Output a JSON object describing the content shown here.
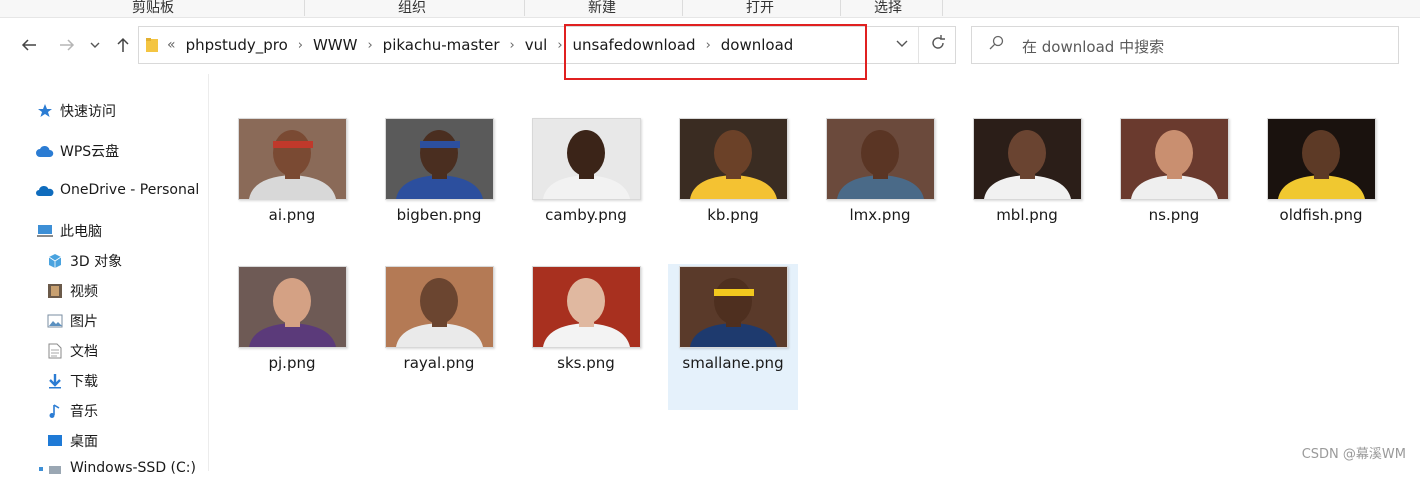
{
  "ribbon": {
    "groups": [
      "剪贴板",
      "组织",
      "新建",
      "打开",
      "选择"
    ]
  },
  "nav": {
    "back_icon": "arrow-left-icon",
    "forward_icon": "arrow-right-icon",
    "recent_icon": "chevron-down-icon",
    "up_icon": "arrow-up-icon"
  },
  "address": {
    "overflow": "«",
    "crumbs": [
      "phpstudy_pro",
      "WWW",
      "pikachu-master",
      "vul",
      "unsafedownload",
      "download"
    ]
  },
  "search": {
    "placeholder": "在 download 中搜索"
  },
  "sidebar": {
    "items": [
      {
        "label": "快速访问",
        "icon": "star-icon"
      },
      {
        "label": "WPS云盘",
        "icon": "cloud-icon"
      },
      {
        "label": "OneDrive - Personal",
        "icon": "onedrive-icon"
      },
      {
        "label": "此电脑",
        "icon": "computer-icon"
      },
      {
        "label": "3D 对象",
        "icon": "cube-icon"
      },
      {
        "label": "视频",
        "icon": "film-icon"
      },
      {
        "label": "图片",
        "icon": "picture-icon"
      },
      {
        "label": "文档",
        "icon": "document-icon"
      },
      {
        "label": "下载",
        "icon": "download-arrow-icon"
      },
      {
        "label": "音乐",
        "icon": "music-note-icon"
      },
      {
        "label": "桌面",
        "icon": "desktop-icon"
      },
      {
        "label": "Windows-SSD (C:)",
        "icon": "drive-icon"
      }
    ]
  },
  "files": [
    {
      "name": "ai.png",
      "bg": "#8a6a58",
      "skin": "#7a4a33",
      "jersey": "#d8d8d8",
      "band": "#c0392b"
    },
    {
      "name": "bigben.png",
      "bg": "#5a5a5a",
      "skin": "#4a2e20",
      "jersey": "#2c4f9e",
      "band": "#2c4f9e"
    },
    {
      "name": "camby.png",
      "bg": "#e8e8e8",
      "skin": "#3b2418",
      "jersey": "#f2f2f2",
      "band": ""
    },
    {
      "name": "kb.png",
      "bg": "#3a2c22",
      "skin": "#6b4128",
      "jersey": "#f4c232",
      "band": ""
    },
    {
      "name": "lmx.png",
      "bg": "#6b4a3c",
      "skin": "#5a3524",
      "jersey": "#4a6a88",
      "band": ""
    },
    {
      "name": "mbl.png",
      "bg": "#2b1e18",
      "skin": "#6a4431",
      "jersey": "#f1f1f1",
      "band": ""
    },
    {
      "name": "ns.png",
      "bg": "#6a3a2e",
      "skin": "#c98f70",
      "jersey": "#efefef",
      "band": ""
    },
    {
      "name": "oldfish.png",
      "bg": "#1a120e",
      "skin": "#5d3a26",
      "jersey": "#f0c830",
      "band": ""
    },
    {
      "name": "pj.png",
      "bg": "#6e5a55",
      "skin": "#d4a184",
      "jersey": "#5b3a7a",
      "band": ""
    },
    {
      "name": "rayal.png",
      "bg": "#b47a55",
      "skin": "#6b4530",
      "jersey": "#eaeaea",
      "band": ""
    },
    {
      "name": "sks.png",
      "bg": "#a8301f",
      "skin": "#e0b8a0",
      "jersey": "#f3f3f3",
      "band": ""
    },
    {
      "name": "smallane.png",
      "bg": "#5a3a2a",
      "skin": "#4e2f1f",
      "jersey": "#1e3a6e",
      "band": "#f2c81e"
    }
  ],
  "selected_file": "smallane.png",
  "watermark": "CSDN @幕溪WM"
}
